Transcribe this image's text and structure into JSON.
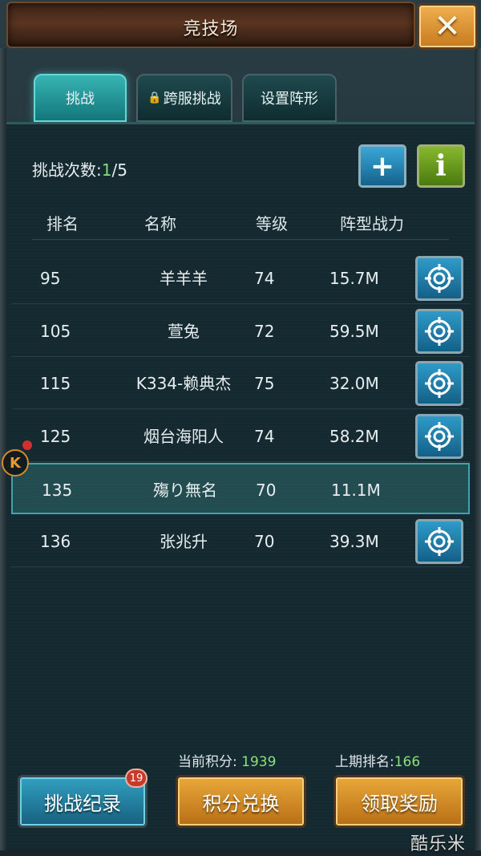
{
  "header": {
    "title": "竞技场",
    "close_icon": "close-icon"
  },
  "tabs": [
    {
      "label": "挑战",
      "active": true
    },
    {
      "label": "跨服挑战",
      "locked": true
    },
    {
      "label": "设置阵形"
    }
  ],
  "challenge": {
    "label": "挑战次数:",
    "current": "1",
    "total": "/5"
  },
  "table": {
    "columns": [
      "排名",
      "名称",
      "等级",
      "阵型战力"
    ],
    "rows": [
      {
        "rank": "95",
        "name": "羊羊羊",
        "level": "74",
        "power": "15.7M",
        "challengeable": true
      },
      {
        "rank": "105",
        "name": "萱兔",
        "level": "72",
        "power": "59.5M",
        "challengeable": true
      },
      {
        "rank": "115",
        "name": "K334-赖典杰",
        "level": "75",
        "power": "32.0M",
        "challengeable": true
      },
      {
        "rank": "125",
        "name": "烟台海阳人",
        "level": "74",
        "power": "58.2M",
        "challengeable": true
      },
      {
        "rank": "135",
        "name": "殤り無名",
        "level": "70",
        "power": "11.1M",
        "challengeable": false,
        "is_self": true
      },
      {
        "rank": "136",
        "name": "张兆升",
        "level": "70",
        "power": "39.3M",
        "challengeable": true
      }
    ]
  },
  "stats": {
    "score_label": "当前积分:",
    "score_value": "1939",
    "last_rank_label": "上期排名:",
    "last_rank_value": "166"
  },
  "buttons": {
    "record": "挑战纪录",
    "record_badge": "19",
    "exchange": "积分兑换",
    "reward": "领取奖励"
  },
  "watermark": "酷乐米",
  "float_icon": "K",
  "colors": {
    "accent_teal": "#38b4b4",
    "highlight_green": "#7fe07a",
    "orange": "#e9a83a"
  }
}
